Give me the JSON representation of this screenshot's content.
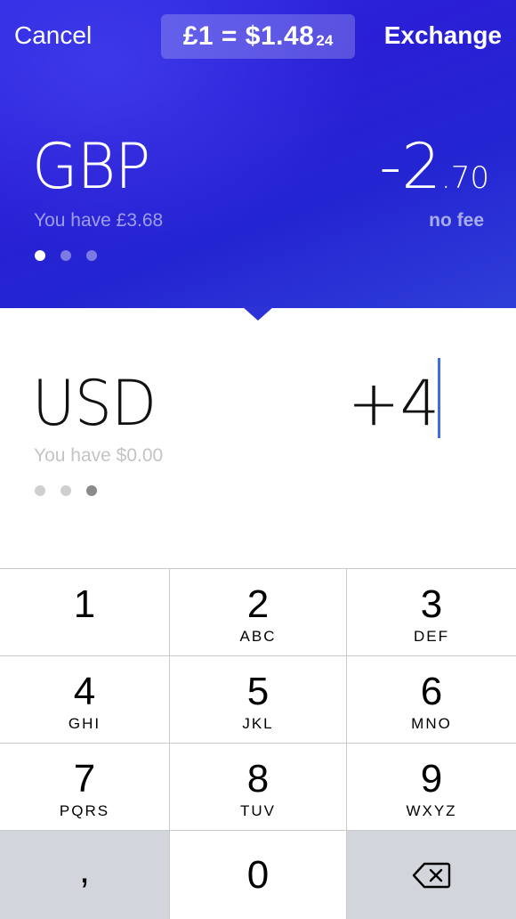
{
  "header": {
    "cancel_label": "Cancel",
    "exchange_label": "Exchange",
    "rate_main": "£1 = $1.48",
    "rate_small": "24"
  },
  "from": {
    "currency": "GBP",
    "balance": "You have £3.68",
    "amount_main": "-2",
    "amount_decimal": ".70",
    "fee": "no fee",
    "page_index": 0,
    "page_count": 3
  },
  "to": {
    "currency": "USD",
    "balance": "You have $0.00",
    "amount": "+4",
    "page_index": 2,
    "page_count": 3
  },
  "keypad": {
    "keys": [
      {
        "num": "1",
        "letters": ""
      },
      {
        "num": "2",
        "letters": "ABC"
      },
      {
        "num": "3",
        "letters": "DEF"
      },
      {
        "num": "4",
        "letters": "GHI"
      },
      {
        "num": "5",
        "letters": "JKL"
      },
      {
        "num": "6",
        "letters": "MNO"
      },
      {
        "num": "7",
        "letters": "PQRS"
      },
      {
        "num": "8",
        "letters": "TUV"
      },
      {
        "num": "9",
        "letters": "WXYZ"
      },
      {
        "num": ",",
        "letters": ""
      },
      {
        "num": "0",
        "letters": ""
      },
      {
        "icon": "backspace-icon"
      }
    ]
  },
  "colors": {
    "gradient_primary": "#2a1fd6",
    "cursor": "#3c6ee6",
    "keypad_gray": "#d2d5db"
  }
}
